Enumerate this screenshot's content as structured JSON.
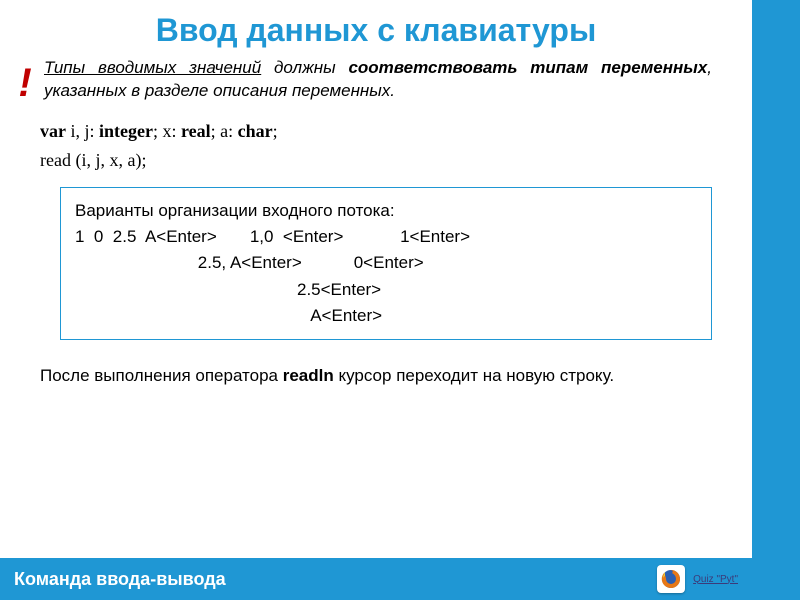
{
  "title": "Ввод данных с клавиатуры",
  "bang": "!",
  "intro": {
    "part1": "Типы вводимых значений",
    "part2": " должны ",
    "part3": "соответствовать типам переменных",
    "part4": ", указанных в разделе описания переменных."
  },
  "code": {
    "line1_parts": {
      "a": "var",
      "b": " i, j: ",
      "c": "integer",
      "d": "; x: ",
      "e": "real",
      "f": "; a: ",
      "g": "char",
      "h": ";"
    },
    "line2": "read (i, j, x, a);"
  },
  "box": {
    "line0": "Варианты организации входного потока:",
    "line1": "1  0  2.5  A<Enter>       1,0  <Enter>            1<Enter>",
    "line2": "                          2.5, A<Enter>           0<Enter>",
    "line3": "                                               2.5<Enter>",
    "line4": "                                                  A<Enter>"
  },
  "note": {
    "a": "После выполнения оператора  ",
    "b": "readln",
    "c": "   курсор переходит на новую строку."
  },
  "footer": {
    "text": "Команда ввода-вывода",
    "quiz": "Quiz \"Pyt\""
  }
}
